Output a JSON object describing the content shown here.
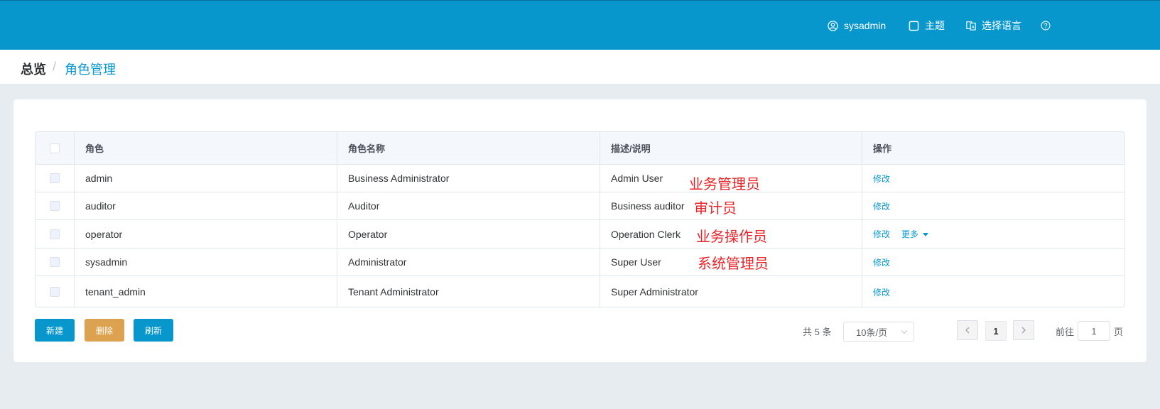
{
  "header": {
    "username": "sysadmin",
    "theme_label": "主题",
    "language_label": "选择语言",
    "help_icon": "question-circle-icon"
  },
  "breadcrumb": {
    "home": "总览",
    "separator": "/",
    "current": "角色管理"
  },
  "table": {
    "columns": [
      "角色",
      "角色名称",
      "描述/说明",
      "操作"
    ],
    "rows": [
      {
        "role": "admin",
        "name": "Business Administrator",
        "desc": "Admin User",
        "annotation": "业务管理员",
        "actions": [
          "修改"
        ]
      },
      {
        "role": "auditor",
        "name": "Auditor",
        "desc": "Business auditor",
        "annotation": "审计员",
        "actions": [
          "修改"
        ]
      },
      {
        "role": "operator",
        "name": "Operator",
        "desc": "Operation Clerk",
        "annotation": "业务操作员",
        "actions": [
          "修改",
          "更多"
        ]
      },
      {
        "role": "sysadmin",
        "name": "Administrator",
        "desc": "Super User",
        "annotation": "系统管理员",
        "actions": [
          "修改"
        ]
      },
      {
        "role": "tenant_admin",
        "name": "Tenant Administrator",
        "desc": "Super Administrator",
        "annotation": "",
        "actions": [
          "修改"
        ]
      }
    ]
  },
  "buttons": {
    "new": "新建",
    "delete": "删除",
    "refresh": "刷新"
  },
  "pagination": {
    "total": "共 5 条",
    "page_size": "10条/页",
    "current_page": "1",
    "goto_label": "前往",
    "goto_value": "1",
    "page_suffix": "页"
  },
  "colors": {
    "primary": "#0797cc",
    "danger_button": "#dca24f",
    "annotation": "#e8262a"
  }
}
